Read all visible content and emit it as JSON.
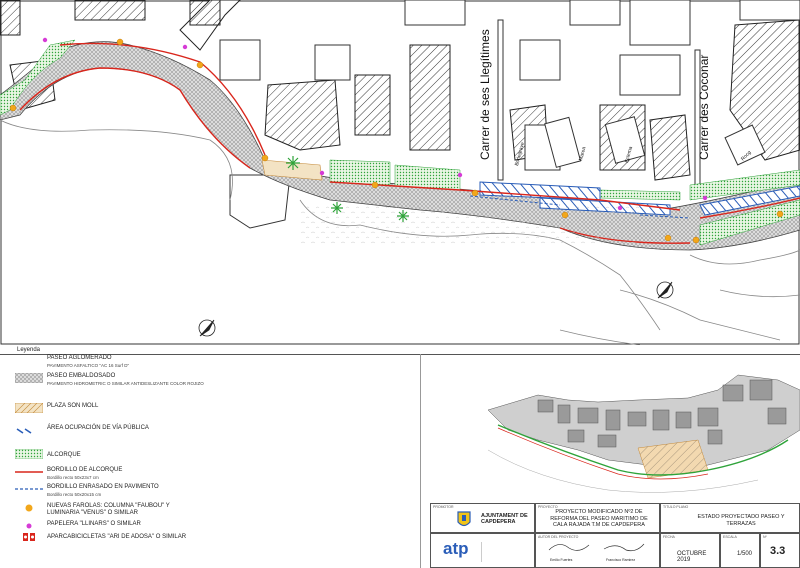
{
  "streets": {
    "llegitimes": "Carrer de ses Llegítimes",
    "coconar": "Carrer des Coconar"
  },
  "building_labels": [
    "Borlegrave",
    "Marea",
    "Eclema",
    "Rocg"
  ],
  "legend": {
    "title": "Leyenda",
    "items": [
      {
        "label": "PASEO AGLOMERADO",
        "sub": "PAVIMENTO ASFALTICO \"AC 16 Surf D\""
      },
      {
        "label": "PASEO EMBALDOSADO",
        "sub": "PAVIMENTO HIDROMETRIC O SIMILAR ANTIDESLIZANTE COLOR ROJIZO"
      },
      {
        "label": "PLAZA SON MOLL",
        "sub": ""
      },
      {
        "label": "ÁREA OCUPACIÓN DE VÍA PÚBLICA",
        "sub": ""
      },
      {
        "label": "ALCORQUE",
        "sub": ""
      },
      {
        "label": "BORDILLO DE ALCORQUE",
        "sub": "Bordillo recto 50x23x7 cm"
      },
      {
        "label": "BORDILLO ENRASADO EN PAVIMENTO",
        "sub": "Bordillo recto 50x20x15 cm"
      },
      {
        "label": "NUEVAS FAROLAS:  COLUMNA \"FAUBOU\" Y",
        "sub": "LUMINARIA \"VENUS\" O SIMILAR"
      },
      {
        "label": "PAPELERA \"LLINARS\" O SIMILAR",
        "sub": ""
      },
      {
        "label": "APARCABICICLETAS \"ARI DE ADOSA\" O SIMILAR",
        "sub": ""
      }
    ]
  },
  "titleblock": {
    "promotor_lbl": "PROMOTOR",
    "ayuntamiento": "AJUNTAMENT DE CAPDEPERA",
    "proyecto_lbl": "PROYECTO",
    "proyecto": "PROYECTO MODIFICADO Nº2 DE REFORMA DEL PASEO MARITIMO DE CALA RAJADA   T.M DE CAPDEPERA",
    "titulo_lbl": "TITULO PLANO",
    "titulo": "ESTADO PROYECTADO PASEO Y TERRAZAS",
    "autor_lbl": "AUTOR DEL PROYECTO",
    "atp": "atp",
    "fecha_lbl": "FECHA",
    "fecha": "OCTUBRE 2019",
    "escala_lbl": "ESCALA",
    "escala": "1/500",
    "num_lbl": "Nº",
    "num": "3.3",
    "firma1": "Emilio Fuertes",
    "firma2": "Francisco Ramirez"
  },
  "colors": {
    "green": "#2fa33a",
    "red": "#d9261c",
    "blue": "#2a5db8",
    "lamp": "#f2a71b",
    "bin": "#d63bd6"
  }
}
